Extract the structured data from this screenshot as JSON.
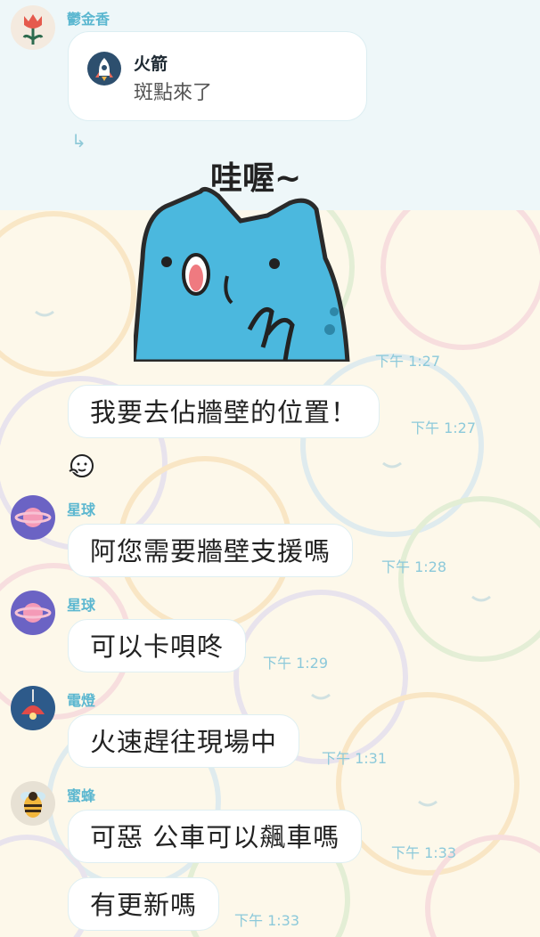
{
  "reply_thread": {
    "sender": "鬱金香",
    "quoted_name": "火箭",
    "quoted_text": "斑點來了"
  },
  "sticker": {
    "caption": "哇喔~",
    "time": "下午 1:27"
  },
  "messages": [
    {
      "sender": "",
      "text": "我要去佔牆壁的位置！",
      "time": "下午 1:27"
    },
    {
      "sender": "星球",
      "text": "阿您需要牆壁支援嗎",
      "time": "下午 1:28"
    },
    {
      "sender": "星球",
      "text": "可以卡唄咚",
      "time": "下午 1:29"
    },
    {
      "sender": "電燈",
      "text": "火速趕往現場中",
      "time": "下午 1:31"
    },
    {
      "sender": "蜜蜂",
      "text": "可惡 公車可以飆車嗎",
      "time": "下午 1:33"
    },
    {
      "sender": "",
      "text": "有更新嗎",
      "time": "下午 1:33"
    }
  ],
  "colors": {
    "accent": "#5bb7d0",
    "bubble": "#ffffff",
    "sticker_blue": "#4bb8de"
  }
}
